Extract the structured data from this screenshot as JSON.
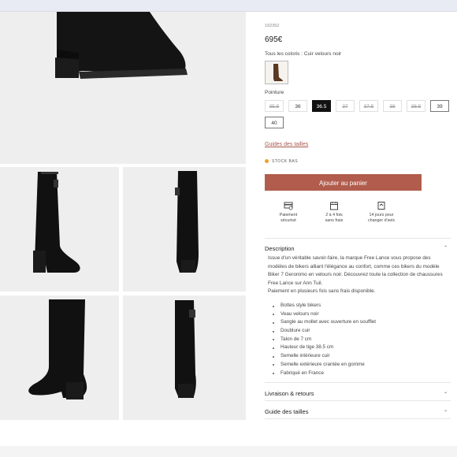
{
  "product": {
    "sku": "192352",
    "price": "695€",
    "colors_text": "Tous les coloris : Cuir velours noir",
    "size_label": "Pointure",
    "sizes": [
      {
        "label": "35.5",
        "state": "unavailable"
      },
      {
        "label": "36",
        "state": "available"
      },
      {
        "label": "36.5",
        "state": "selected"
      },
      {
        "label": "37",
        "state": "unavailable"
      },
      {
        "label": "37.5",
        "state": "unavailable"
      },
      {
        "label": "38",
        "state": "unavailable"
      },
      {
        "label": "38.5",
        "state": "unavailable"
      },
      {
        "label": "39",
        "state": "available"
      },
      {
        "label": "40",
        "state": "available"
      }
    ],
    "size_guide_link": "Guides des tailles",
    "stock_text": "STOCK BAS",
    "add_to_cart": "Ajouter au panier",
    "features": [
      {
        "icon": "payment-icon",
        "line1": "Paiement",
        "line2": "sécurisé"
      },
      {
        "icon": "calendar-icon",
        "line1": "2 à 4 fois",
        "line2": "sans frais"
      },
      {
        "icon": "return-icon",
        "line1": "14 jours pour",
        "line2": "changer d'avis"
      }
    ]
  },
  "accordion": {
    "description_title": "Description",
    "description_text": "Issue d'un véritable savoir-faire, la marque Free Lance vous propose des modèles de bikers alliant l'élégance au confort, comme ces bikers du modèle Biker 7 Geronimo en velours noir. Découvrez toute la collection de chaussures Free Lance sur Ann Tuil.",
    "payment_text": "Paiement en plusieurs fois sans frais disponible.",
    "bullets": [
      "Bottes style bikers",
      "Veau velours noir",
      "Sangle au mollet avec ouverture en soufflet",
      "Doublure cuir",
      "Talon de 7 cm",
      "Hauteur de tige 38.5 cm",
      "Semelle intérieure cuir",
      "Semelle extérieure crantée en gomme",
      "Fabriqué en France"
    ],
    "delivery_title": "Livraison & retours",
    "guide_title": "Guide des tailles"
  },
  "colors": {
    "accent": "#b15c4c",
    "stock_dot": "#f0a02a",
    "selected_size": "#111111"
  }
}
